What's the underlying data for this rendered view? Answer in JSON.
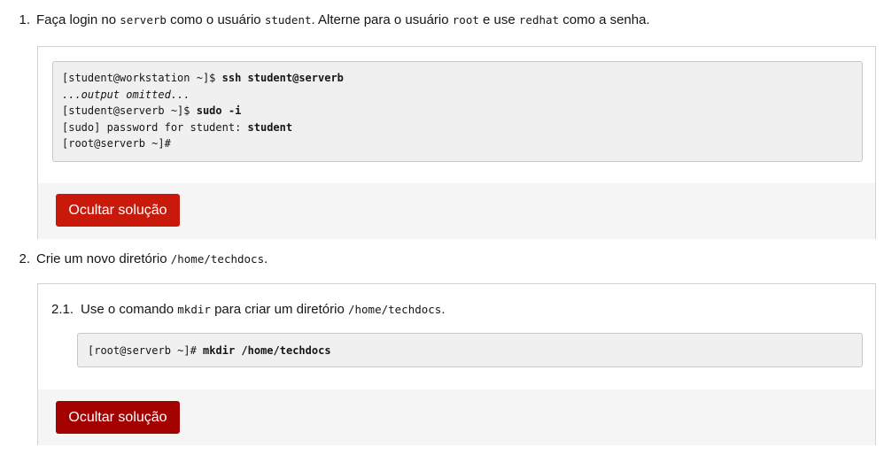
{
  "steps": [
    {
      "number": "1.",
      "parts": [
        "Faça login no ",
        "serverb",
        " como o usuário ",
        "student",
        ". Alterne para o usuário ",
        "root",
        " e use ",
        "redhat",
        " como a senha."
      ],
      "terminal": {
        "l1_prompt": "[student@workstation ~]$ ",
        "l1_cmd": "ssh student@serverb",
        "l2": "...output omitted...",
        "l3_prompt": "[student@serverb ~]$ ",
        "l3_cmd": "sudo -i",
        "l4_prompt": "[sudo] password for student: ",
        "l4_cmd": "student",
        "l5": "[root@serverb ~]#"
      },
      "button": "Ocultar solução"
    },
    {
      "number": "2.",
      "parts": [
        "Crie um novo diretório ",
        "/home/techdocs",
        "."
      ],
      "substep": {
        "number": "2.1.",
        "parts": [
          "Use o comando ",
          "mkdir",
          " para criar um diretório ",
          "/home/techdocs",
          "."
        ],
        "terminal": {
          "prompt": "[root@serverb ~]# ",
          "cmd": "mkdir /home/techdocs"
        }
      },
      "button": "Ocultar solução"
    }
  ],
  "colors": {
    "button": "#c9190b",
    "button_hover": "#a30000"
  }
}
